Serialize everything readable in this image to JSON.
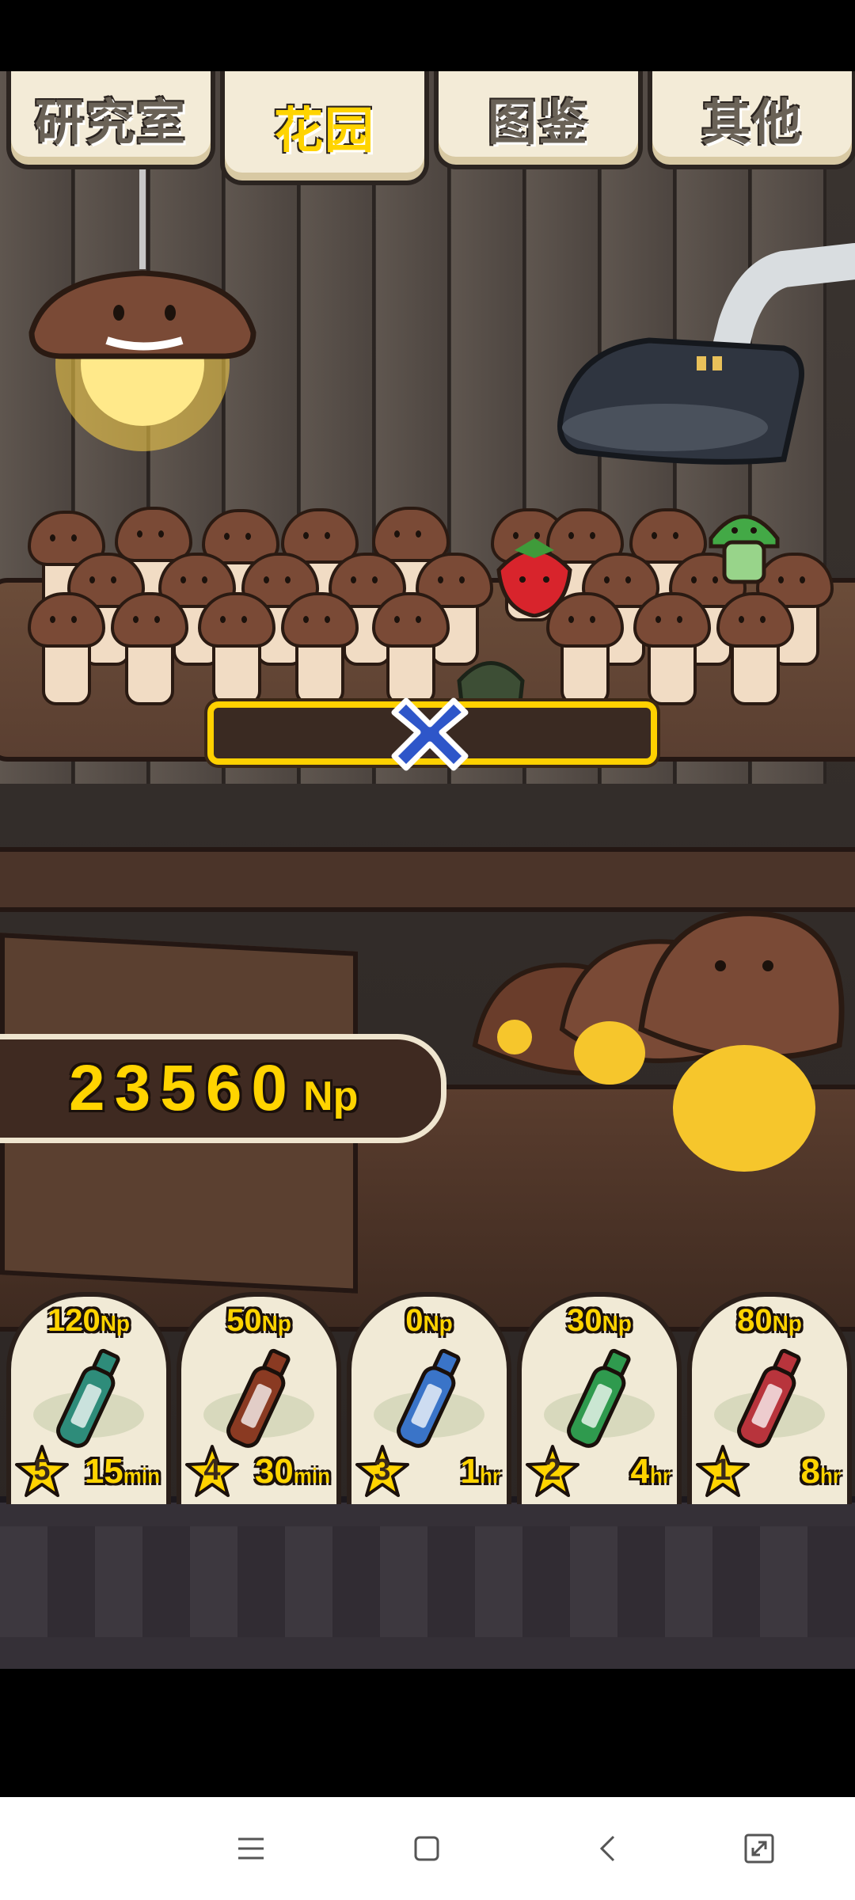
{
  "tabs": [
    {
      "label": "研究室",
      "active": false
    },
    {
      "label": "花园",
      "active": true
    },
    {
      "label": "图鉴",
      "active": false
    },
    {
      "label": "其他",
      "active": false
    }
  ],
  "garden": {
    "progress_fraction": 0,
    "close_icon": "close-x-icon"
  },
  "np_counter": {
    "value": "23560",
    "unit": "Np"
  },
  "items": [
    {
      "price": "120",
      "price_unit": "Np",
      "stars": "5",
      "time_value": "15",
      "time_unit": "min",
      "bottle_color": "#2e8c7a",
      "icon": "teal-bottle-icon"
    },
    {
      "price": "50",
      "price_unit": "Np",
      "stars": "4",
      "time_value": "30",
      "time_unit": "min",
      "bottle_color": "#8a3a22",
      "icon": "brown-vial-icon"
    },
    {
      "price": "0",
      "price_unit": "Np",
      "stars": "3",
      "time_value": "1",
      "time_unit": "hr",
      "bottle_color": "#3a74c8",
      "icon": "blue-vial-icon"
    },
    {
      "price": "30",
      "price_unit": "Np",
      "stars": "2",
      "time_value": "4",
      "time_unit": "hr",
      "bottle_color": "#2f9a4e",
      "icon": "green-ampoule-icon"
    },
    {
      "price": "80",
      "price_unit": "Np",
      "stars": "1",
      "time_value": "8",
      "time_unit": "hr",
      "bottle_color": "#b8343c",
      "icon": "red-ampoule-icon"
    }
  ],
  "system_nav": {
    "menu_icon": "menu-icon",
    "home_icon": "home-icon",
    "back_icon": "back-icon",
    "fullscreen_icon": "fullscreen-icon"
  },
  "colors": {
    "accent_yellow": "#ffd400",
    "tab_bg": "#f3ebd7",
    "wood": "#6b4c39"
  }
}
